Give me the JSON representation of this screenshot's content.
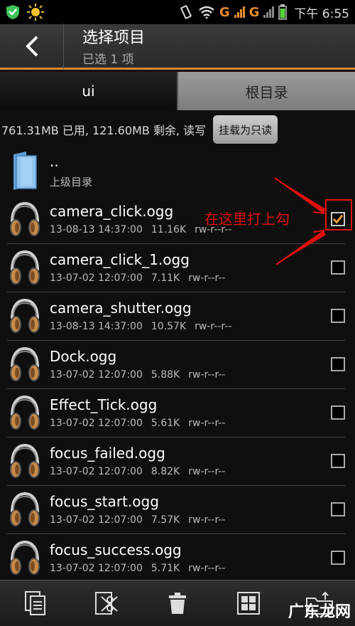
{
  "status_bar": {
    "network_letter_1": "G",
    "network_letter_2": "G",
    "time": "下午 6:55"
  },
  "header": {
    "title": "选择项目",
    "subtitle": "已选 1 项"
  },
  "tabs": [
    {
      "label": "ui",
      "active": true
    },
    {
      "label": "根目录",
      "active": false
    }
  ],
  "storage": {
    "text": "761.31MB 已用, 121.60MB 剩余, 读写",
    "mount_button": "挂载为只读"
  },
  "parent": {
    "name": "..",
    "label": "上级目录"
  },
  "files": [
    {
      "name": "camera_click.ogg",
      "date": "13-08-13 14:37:00",
      "size": "11.16K",
      "perm": "rw-r--r--",
      "checked": true
    },
    {
      "name": "camera_click_1.ogg",
      "date": "13-07-02 12:07:00",
      "size": "7.11K",
      "perm": "rw-r--r--",
      "checked": false
    },
    {
      "name": "camera_shutter.ogg",
      "date": "13-08-13 14:37:00",
      "size": "10.57K",
      "perm": "rw-r--r--",
      "checked": false
    },
    {
      "name": "Dock.ogg",
      "date": "13-07-02 12:07:00",
      "size": "5.88K",
      "perm": "rw-r--r--",
      "checked": false
    },
    {
      "name": "Effect_Tick.ogg",
      "date": "13-07-02 12:07:00",
      "size": "5.61K",
      "perm": "rw-r--r--",
      "checked": false
    },
    {
      "name": "focus_failed.ogg",
      "date": "13-07-02 12:07:00",
      "size": "8.82K",
      "perm": "rw-r--r--",
      "checked": false
    },
    {
      "name": "focus_start.ogg",
      "date": "13-07-02 12:07:00",
      "size": "7.57K",
      "perm": "rw-r--r--",
      "checked": false
    },
    {
      "name": "focus_success.ogg",
      "date": "13-07-02 12:07:00",
      "size": "5.71K",
      "perm": "rw-r--r--",
      "checked": false
    }
  ],
  "annotation": {
    "text": "在这里打上勾"
  },
  "toolbar": {
    "buttons": [
      "copy-icon",
      "cut-icon",
      "delete-icon",
      "select-all-icon",
      "more-icon"
    ]
  },
  "watermark": "广东龙网",
  "colors": {
    "accent": "#d68a2e",
    "annotation": "#e01010"
  }
}
